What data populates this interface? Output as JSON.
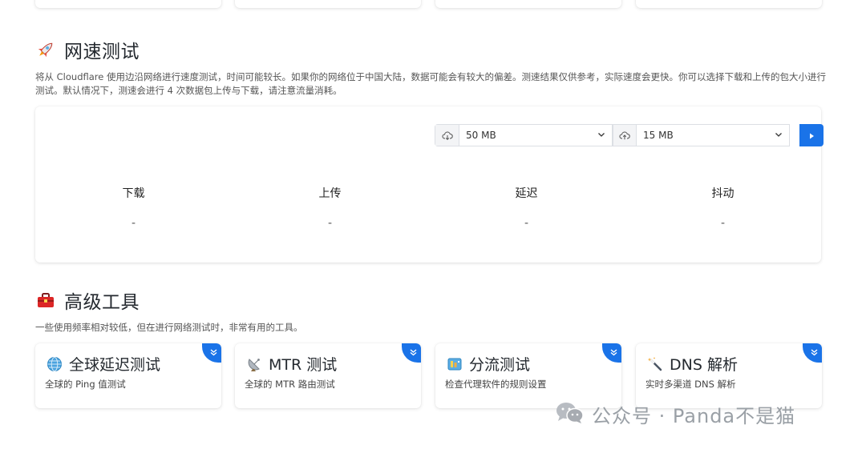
{
  "speed_test": {
    "title": "网速测试",
    "description_line1": "将从 Cloudflare 使用边沿网络进行速度测试，时间可能较长。如果你的网络位于中国大陆，数据可能会有较大的偏差。测速结果仅供参考，实际速度会更快。你可以选择下载和上传的包大小进行",
    "description_line2": "测试。默认情况下，测速会进行 4 次数据包上传与下载，请注意流量消耗。",
    "download_size": "50 MB",
    "upload_size": "15 MB",
    "metrics": [
      {
        "label": "下载",
        "value": "-"
      },
      {
        "label": "上传",
        "value": "-"
      },
      {
        "label": "延迟",
        "value": "-"
      },
      {
        "label": "抖动",
        "value": "-"
      }
    ]
  },
  "advanced_tools": {
    "title": "高级工具",
    "description": "一些使用频率相对较低，但在进行网络测试时，非常有用的工具。",
    "tools": [
      {
        "title": "全球延迟测试",
        "subtitle": "全球的 Ping 值测试",
        "icon": "globe-icon"
      },
      {
        "title": "MTR 测试",
        "subtitle": "全球的 MTR 路由测试",
        "icon": "satellite-icon"
      },
      {
        "title": "分流测试",
        "subtitle": "检查代理软件的规则设置",
        "icon": "control-panel-icon"
      },
      {
        "title": "DNS 解析",
        "subtitle": "实时多渠道 DNS 解析",
        "icon": "magic-wand-icon"
      }
    ]
  },
  "watermark": {
    "text": "公众号 · Panda不是猫"
  },
  "colors": {
    "accent": "#1a73e8",
    "text": "#24292f",
    "muted": "#555555",
    "watermark": "#9aa0a6"
  }
}
